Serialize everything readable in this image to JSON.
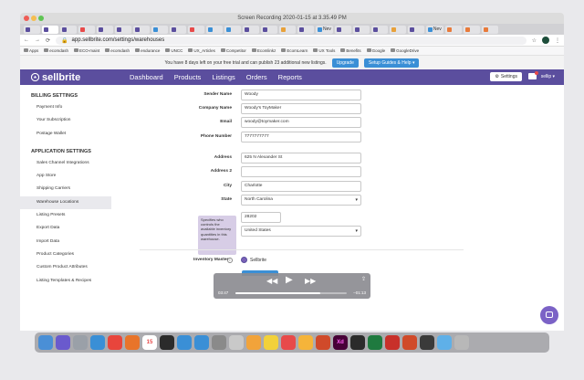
{
  "window": {
    "title": "Screen Recording 2020-01-15 at 3.35.49 PM"
  },
  "browser": {
    "tabs": [
      {
        "label": "",
        "color": "#5b4e9e"
      },
      {
        "label": "",
        "color": "#5b4e9e"
      },
      {
        "label": "",
        "color": "#5b4e9e"
      },
      {
        "label": "",
        "color": "#e84a4a"
      },
      {
        "label": "",
        "color": "#5b4e9e"
      },
      {
        "label": "",
        "color": "#5b4e9e"
      },
      {
        "label": "",
        "color": "#5b4e9e"
      },
      {
        "label": "",
        "color": "#3a8fd6"
      },
      {
        "label": "",
        "color": "#5b4e9e"
      },
      {
        "label": "",
        "color": "#e84a4a"
      },
      {
        "label": "",
        "color": "#3a8fd6"
      },
      {
        "label": "",
        "color": "#3a8fd6"
      },
      {
        "label": "",
        "color": "#5b4e9e"
      },
      {
        "label": "",
        "color": "#5b4e9e"
      },
      {
        "label": "",
        "color": "#e8a13a"
      },
      {
        "label": "",
        "color": "#5b4e9e"
      },
      {
        "label": "Nev",
        "color": "#3a8fd6"
      },
      {
        "label": "",
        "color": "#5b4e9e"
      },
      {
        "label": "",
        "color": "#5b4e9e"
      },
      {
        "label": "",
        "color": "#5b4e9e"
      },
      {
        "label": "",
        "color": "#e8a13a"
      },
      {
        "label": "",
        "color": "#5b4e9e"
      },
      {
        "label": "Nev",
        "color": "#3a8fd6"
      },
      {
        "label": "",
        "color": "#e87a3a"
      },
      {
        "label": "",
        "color": "#e87a3a"
      },
      {
        "label": "",
        "color": "#e87a3a"
      }
    ],
    "url": "app.sellbrite.com/settings/warehouses",
    "bookmarks": [
      "Apps",
      "ecomdash",
      "ECO-maint",
      "ecomdash",
      "endurance",
      "UNCC",
      "UX_Articles",
      "Competitor",
      "Ecomlinkz",
      "EcomLearn",
      "UX Tools",
      "Benefits",
      "Google",
      "GoogleDrive"
    ]
  },
  "trial": {
    "text": "You have 8 days left on your free trial and can publish 23 additional new listings.",
    "upgrade_label": "Upgrade",
    "guides_label": "Setup Guides & Help ▾"
  },
  "nav": {
    "logo": "sellbrite",
    "links": [
      "Dashboard",
      "Products",
      "Listings",
      "Orders",
      "Reports"
    ],
    "settings_label": "Settings",
    "user_label": "sellip ▾"
  },
  "sidebar": {
    "billing_heading": "Billing Settings",
    "billing_items": [
      "Payment Info",
      "Your Subscription",
      "Postage Wallet"
    ],
    "app_heading": "Application Settings",
    "app_items": [
      "Sales Channel Integrations",
      "App Store",
      "Shipping Carriers",
      "Warehouse Locations",
      "Listing Presets",
      "Export Data",
      "Import Data",
      "Product Categories",
      "Custom Product Attributes",
      "Listing Templates & Recipes"
    ],
    "active_item": "Warehouse Locations"
  },
  "form": {
    "fields": [
      {
        "label": "Sender Name",
        "value": ""
      },
      {
        "label": "Company Name",
        "value": "Woody's ToyMaker"
      },
      {
        "label": "Email",
        "value": "woody@toymaker.com"
      },
      {
        "label": "Phone Number",
        "value": "7777777777"
      },
      {
        "label": "Address",
        "value": "625 N Alexander St"
      },
      {
        "label": "Address 2",
        "value": ""
      },
      {
        "label": "City",
        "value": "Charlotte"
      },
      {
        "label": "State",
        "value": "North Carolina"
      },
      {
        "label": "",
        "value": "28202"
      },
      {
        "label": "",
        "value": "United States"
      }
    ],
    "sender_value": "Woody",
    "tooltip": "Specifies who controls the available inventory quantities in this warehouse.",
    "inventory_master_label": "Inventory Master",
    "inventory_master_option": "Sellbrite"
  },
  "video": {
    "elapsed": "03:47",
    "remaining": "–01:13",
    "progress": 0.76
  },
  "dock": {
    "icons": [
      "finder-icon",
      "siri-icon",
      "launchpad-icon",
      "safari-icon",
      "chrome-icon",
      "firefox-icon",
      "calendar-icon",
      "terminal-icon",
      "mail-icon",
      "appstore-icon",
      "system-preferences-icon",
      "preview-icon",
      "photos-icon",
      "notes-icon",
      "news-icon",
      "sketch-icon",
      "powerpoint-icon",
      "xd-icon",
      "activity-monitor-icon",
      "excel-icon",
      "acrobat-icon",
      "powerpoint-icon",
      "screen-recorder-icon",
      "folder-icon",
      "trash-icon"
    ],
    "calendar_day": "15",
    "xd_label": "Xd"
  }
}
